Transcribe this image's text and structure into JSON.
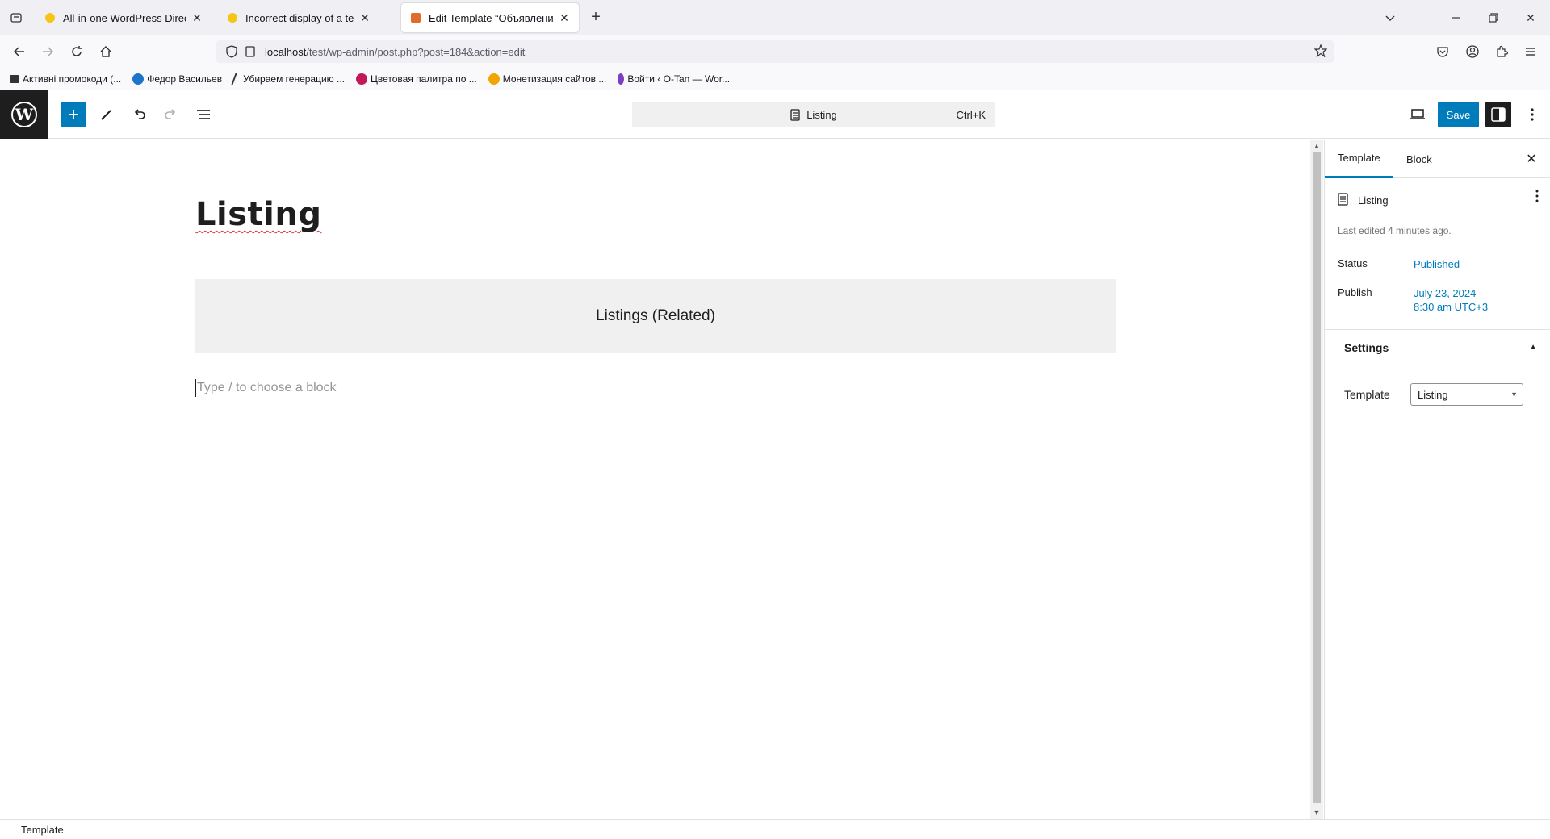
{
  "browser": {
    "tabs": [
      {
        "title": "All-in-one WordPress Directory",
        "favicon_color": "#f5c518"
      },
      {
        "title": "Incorrect display of a template",
        "favicon_color": "#f5c518"
      },
      {
        "title": "Edit Template “Объявление” ‹ t",
        "favicon_color": "#e06b2b"
      }
    ],
    "url_host": "localhost",
    "url_path": "/test/wp-admin/post.php?post=184&action=edit",
    "bookmarks": [
      {
        "label": "Активні промокоди (...",
        "icon_color": "#333333"
      },
      {
        "label": "Федор Васильев",
        "icon_color": "#1d74c9"
      },
      {
        "label": "Убираем генерацию ...",
        "icon_color": "#333333"
      },
      {
        "label": "Цветовая палитра по ...",
        "icon_color": "#c2185b"
      },
      {
        "label": "Монетизация сайтов ...",
        "icon_color": "#f0a500"
      },
      {
        "label": "Войти ‹ O-Tan — Wor...",
        "icon_color": "#7b3fbf"
      }
    ]
  },
  "editor": {
    "command_center": {
      "label": "Listing",
      "shortcut": "Ctrl+K"
    },
    "save_label": "Save",
    "post_title": "Listing",
    "related_block_label": "Listings (Related)",
    "appender_placeholder": "Type / to choose a block",
    "accent_color": "#007cba"
  },
  "sidebar": {
    "tabs": [
      "Template",
      "Block"
    ],
    "template_name": "Listing",
    "last_edited": "Last edited 4 minutes ago.",
    "status_label": "Status",
    "status_value": "Published",
    "publish_label": "Publish",
    "publish_date": "July 23, 2024",
    "publish_time": "8:30 am UTC+3",
    "settings_title": "Settings",
    "template_label": "Template",
    "template_value": "Listing"
  },
  "footer": {
    "breadcrumb": "Template"
  }
}
